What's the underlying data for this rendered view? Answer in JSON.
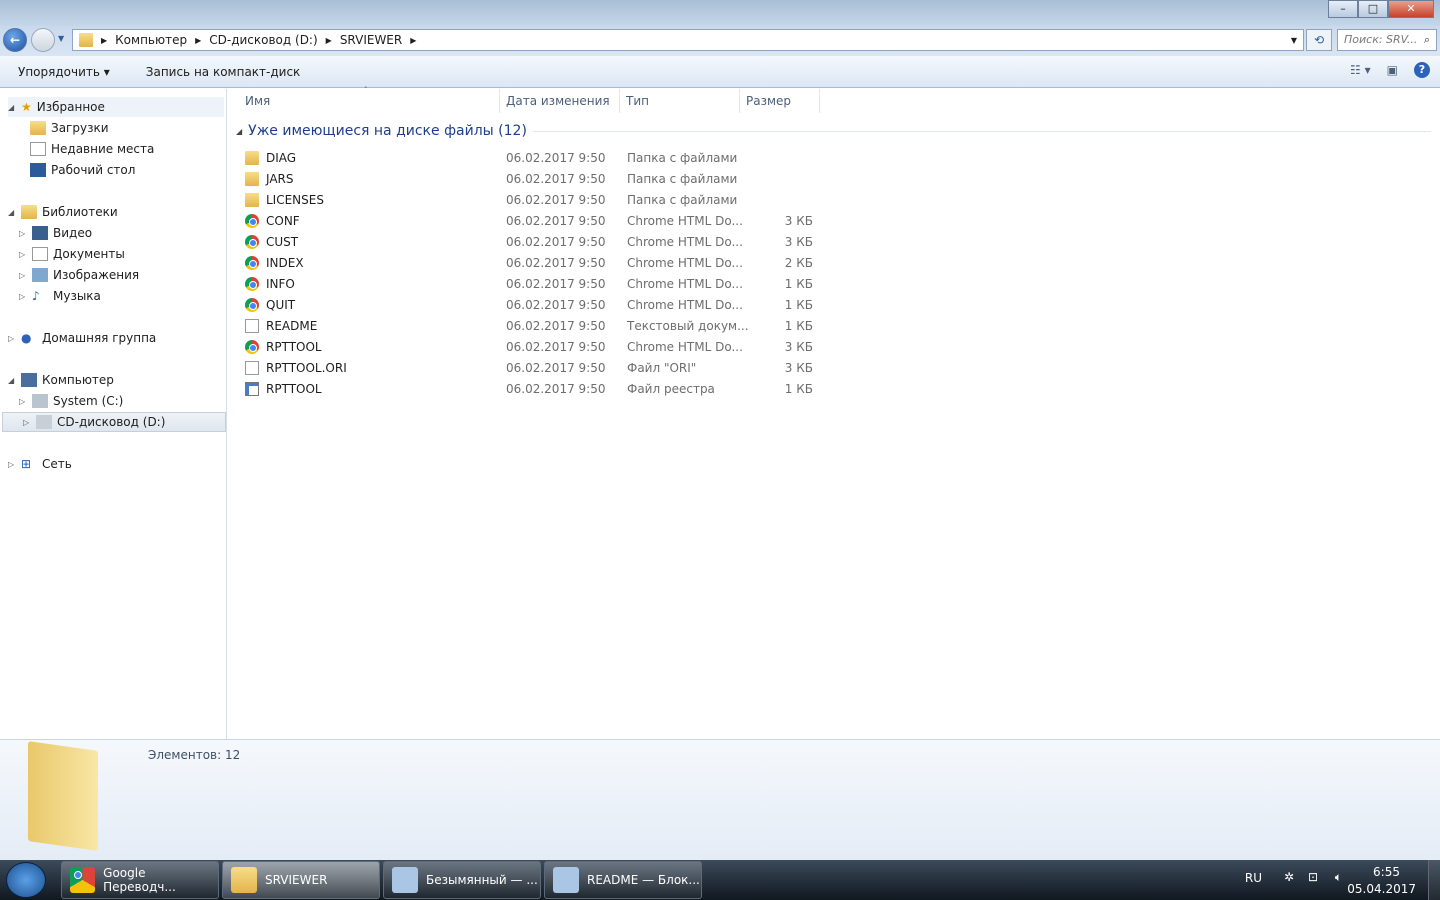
{
  "address": {
    "crumbs": [
      "Компьютер",
      "CD-дисковод (D:)",
      "SRVIEWER"
    ],
    "search_placeholder": "Поиск: SRV..."
  },
  "toolbar": {
    "organize": "Упорядочить ▾",
    "burn": "Запись на компакт-диск"
  },
  "nav": {
    "favorites": "Избранное",
    "downloads": "Загрузки",
    "recent": "Недавние места",
    "desktop": "Рабочий стол",
    "libraries": "Библиотеки",
    "video": "Видео",
    "documents": "Документы",
    "images": "Изображения",
    "music": "Музыка",
    "homegroup": "Домашняя группа",
    "computer": "Компьютер",
    "system": "System (C:)",
    "cd": "CD-дисковод (D:)",
    "network": "Сеть"
  },
  "columns": {
    "name": "Имя",
    "date": "Дата изменения",
    "type": "Тип",
    "size": "Размер"
  },
  "group": "Уже имеющиеся на диске файлы (12)",
  "files": [
    {
      "name": "DIAG",
      "date": "06.02.2017 9:50",
      "type": "Папка с файлами",
      "size": "",
      "icon": "folder"
    },
    {
      "name": "JARS",
      "date": "06.02.2017 9:50",
      "type": "Папка с файлами",
      "size": "",
      "icon": "folder"
    },
    {
      "name": "LICENSES",
      "date": "06.02.2017 9:50",
      "type": "Папка с файлами",
      "size": "",
      "icon": "folder"
    },
    {
      "name": "CONF",
      "date": "06.02.2017 9:50",
      "type": "Chrome HTML Do...",
      "size": "3 КБ",
      "icon": "chrome"
    },
    {
      "name": "CUST",
      "date": "06.02.2017 9:50",
      "type": "Chrome HTML Do...",
      "size": "3 КБ",
      "icon": "chrome"
    },
    {
      "name": "INDEX",
      "date": "06.02.2017 9:50",
      "type": "Chrome HTML Do...",
      "size": "2 КБ",
      "icon": "chrome"
    },
    {
      "name": "INFO",
      "date": "06.02.2017 9:50",
      "type": "Chrome HTML Do...",
      "size": "1 КБ",
      "icon": "chrome"
    },
    {
      "name": "QUIT",
      "date": "06.02.2017 9:50",
      "type": "Chrome HTML Do...",
      "size": "1 КБ",
      "icon": "chrome"
    },
    {
      "name": "README",
      "date": "06.02.2017 9:50",
      "type": "Текстовый докум...",
      "size": "1 КБ",
      "icon": "txt"
    },
    {
      "name": "RPTTOOL",
      "date": "06.02.2017 9:50",
      "type": "Chrome HTML Do...",
      "size": "3 КБ",
      "icon": "chrome"
    },
    {
      "name": "RPTTOOL.ORI",
      "date": "06.02.2017 9:50",
      "type": "Файл \"ORI\"",
      "size": "3 КБ",
      "icon": "txt"
    },
    {
      "name": "RPTTOOL",
      "date": "06.02.2017 9:50",
      "type": "Файл реестра",
      "size": "1 КБ",
      "icon": "reg"
    }
  ],
  "details": {
    "count": "Элементов: 12"
  },
  "taskbar": {
    "items": [
      "Google Переводч...",
      "SRVIEWER",
      "Безымянный — ...",
      "README — Блок..."
    ],
    "lang": "RU",
    "time": "6:55",
    "date": "05.04.2017"
  }
}
